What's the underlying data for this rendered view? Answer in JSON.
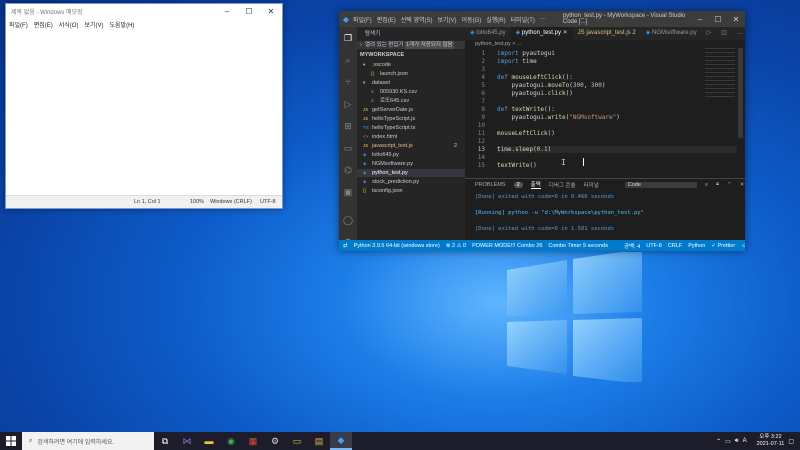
{
  "notepad": {
    "title": "제목 없음 - Windows 메모장",
    "menu": [
      "파일(F)",
      "편집(E)",
      "서식(O)",
      "보기(V)",
      "도움말(H)"
    ],
    "status": {
      "position": "Ln 1, Col 1",
      "zoom": "100%",
      "eol": "Windows (CRLF)",
      "encoding": "UTF-8"
    }
  },
  "vscode": {
    "menu": [
      "파일(F)",
      "편집(E)",
      "선택 영역(S)",
      "보기(V)",
      "이동(G)",
      "실행(R)",
      "터미널(T)",
      "..."
    ],
    "window_title": "python_test.py - MyWorkspace - Visual Studio Code [...]",
    "sidebar": {
      "header": "탐색기",
      "open_editors": "열려 있는 편집기",
      "unsaved": "1개가 저장되지 않음",
      "workspace": "MYWORKSPACE",
      "outline": "개요",
      "items": [
        {
          "label": ".vscode",
          "kind": "folder",
          "color": "#cccccc"
        },
        {
          "label": "launch.json",
          "kind": "json",
          "color": "#cccccc"
        },
        {
          "label": "dataset",
          "kind": "folder",
          "color": "#cccccc"
        },
        {
          "label": "005930.KS.csv",
          "kind": "csv",
          "color": "#cccccc"
        },
        {
          "label": "로또645.csv",
          "kind": "csv",
          "color": "#cccccc"
        },
        {
          "label": "getServerDate.js",
          "kind": "js",
          "color": "#cccccc"
        },
        {
          "label": "helloTypeScript.js",
          "kind": "js",
          "color": "#cccccc"
        },
        {
          "label": "helloTypeScript.ts",
          "kind": "ts",
          "color": "#cccccc"
        },
        {
          "label": "index.html",
          "kind": "html",
          "color": "#cccccc"
        },
        {
          "label": "javascript_test.js",
          "kind": "js",
          "color": "#e2c08d",
          "badge": "2"
        },
        {
          "label": "lotto645.py",
          "kind": "py",
          "color": "#cccccc"
        },
        {
          "label": "NGMsoftware.py",
          "kind": "py",
          "color": "#cccccc"
        },
        {
          "label": "python_test.py",
          "kind": "py",
          "color": "#ffffff",
          "active": true
        },
        {
          "label": "stock_prediction.py",
          "kind": "py",
          "color": "#cccccc"
        },
        {
          "label": "tsconfig.json",
          "kind": "json",
          "color": "#cccccc"
        }
      ]
    },
    "tabs": [
      {
        "label": "lotto645.py"
      },
      {
        "label": "python_test.py",
        "active": true
      },
      {
        "label": "javascript_test.js 2"
      },
      {
        "label": "NGMsoftware.py"
      }
    ],
    "breadcrumb": "python_test.py > ...",
    "code_lines": [
      {
        "n": "1",
        "text": "import pyautogui"
      },
      {
        "n": "2",
        "text": "import time"
      },
      {
        "n": "3",
        "text": ""
      },
      {
        "n": "4",
        "text": "def mouseLeftClick():"
      },
      {
        "n": "5",
        "text": "    pyautogui.moveTo(300, 300)"
      },
      {
        "n": "6",
        "text": "    pyautogui.click()"
      },
      {
        "n": "7",
        "text": ""
      },
      {
        "n": "8",
        "text": "def textWrite():"
      },
      {
        "n": "9",
        "text": "    pyautogui.write(\"NGMsoftware\")"
      },
      {
        "n": "10",
        "text": ""
      },
      {
        "n": "11",
        "text": "mouseLeftClick()"
      },
      {
        "n": "12",
        "text": ""
      },
      {
        "n": "13",
        "text": "time.sleep(0.1)"
      },
      {
        "n": "14",
        "text": ""
      },
      {
        "n": "15",
        "text": "textWrite()"
      }
    ],
    "panel": {
      "tabs": [
        "PROBLEMS",
        "2",
        "출력",
        "디버그 콘솔",
        "터미널"
      ],
      "dropdown": "Code",
      "lines": [
        "[Done] exited with code=0 in 0.466 seconds",
        "",
        "[Running] python -u \"d:\\MyWorkspace\\python_test.py\"",
        "",
        "[Done] exited with code=0 in 1.581 seconds"
      ]
    },
    "status": {
      "python": "Python 3.9.5 64-bit (windows store)",
      "errors": "⊗ 2 ⚠ 0",
      "power": "POWER MODE!!! Combo 26",
      "timer": "Combo Timer 9 seconds",
      "spaces": "공백: 4",
      "encoding": "UTF-8",
      "eol": "CRLF",
      "lang": "Python",
      "prettier": "✓ Prettier"
    }
  },
  "taskbar": {
    "search_placeholder": "검색하려면 여기에 입력하세요.",
    "time": "오후 3:22",
    "date": "2021-07-11",
    "ime": "A"
  },
  "colors": {
    "accent": "#007acc",
    "keyword": "#569cd6",
    "function": "#dcdcaa",
    "string": "#ce9178",
    "number": "#b5cea8"
  }
}
